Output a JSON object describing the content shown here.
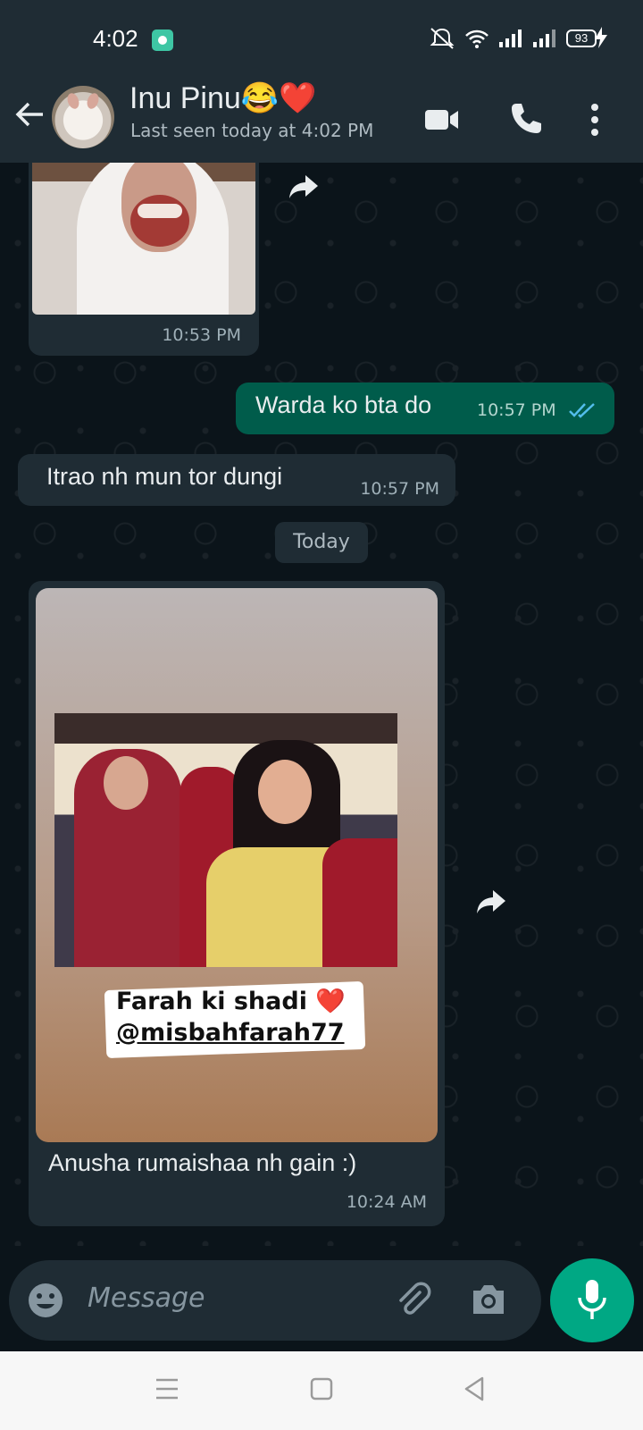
{
  "status_bar": {
    "time": "4:02",
    "battery": "93"
  },
  "header": {
    "contact_name": "Inu Pinu😂❤️",
    "last_seen": "Last seen today at 4:02 PM"
  },
  "messages": [
    {
      "time": "10:53 PM"
    },
    {
      "text": "Warda ko bta do",
      "time": "10:57 PM"
    },
    {
      "text": "Itrao nh mun tor dungi",
      "time": "10:57 PM"
    },
    {
      "date_chip": "Today"
    },
    {
      "image_text_line1": "Farah ki shadi ❤️",
      "image_text_line2": "@misbahfarah77",
      "caption": "Anusha rumaishaa nh gain :)",
      "time": "10:24 AM"
    }
  ],
  "composer": {
    "placeholder": "Message"
  },
  "colors": {
    "header": "#1f2c34",
    "outgoing": "#005c4b",
    "incoming": "#1f2c34",
    "accent": "#00a884"
  }
}
